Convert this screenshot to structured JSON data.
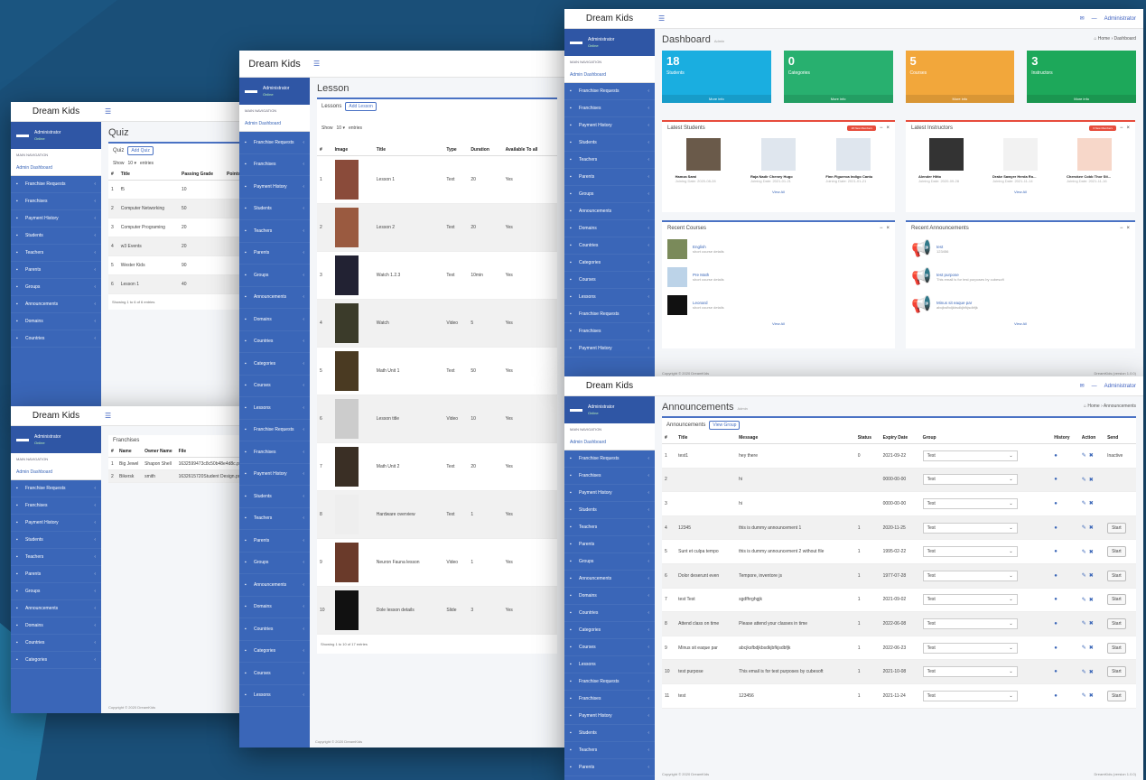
{
  "brand": "Dream Kids",
  "user": {
    "name": "Administrator",
    "status": "Online"
  },
  "nav_header": "MAIN NAVIGATION",
  "nav_dashboard": "Admin Dashboard",
  "nav_items": [
    "Franchise Requests",
    "Franchises",
    "Payment History",
    "Students",
    "Teachers",
    "Parents",
    "Groups",
    "Announcements",
    "Domains",
    "Countries",
    "Categories",
    "Courses",
    "Lessons"
  ],
  "top_user": "Administrator",
  "quiz": {
    "title": "Quiz",
    "tab": "Quiz",
    "add_btn": "Add Quiz",
    "show": "Show",
    "entries": "entries",
    "headers": [
      "#",
      "Title",
      "Passing Grade",
      "Points"
    ],
    "rows": [
      [
        "1",
        "f5",
        "10",
        ""
      ],
      [
        "2",
        "Computer Networking",
        "50",
        ""
      ],
      [
        "3",
        "Computer Programing",
        "20",
        ""
      ],
      [
        "4",
        "w3 Events",
        "20",
        ""
      ],
      [
        "5",
        "Wester Kids",
        "90",
        ""
      ],
      [
        "6",
        "Lesson 1",
        "40",
        ""
      ]
    ],
    "info": "Showing 1 to 6 of 6 entries",
    "footer": "Copyright © 2020 DreamKids"
  },
  "franchises": {
    "title": "Franchises",
    "headers": [
      "#",
      "Name",
      "Owner Name",
      "File"
    ],
    "rows": [
      [
        "1",
        "Big Jewel",
        "Shapon Shell",
        "1632599473c8c50b48e4d8c.pdf"
      ],
      [
        "2",
        "Bikersk",
        "smith",
        "1632615720Student Design.pdf"
      ]
    ],
    "footer": "Copyright © 2020 DreamKids"
  },
  "lesson": {
    "title": "Lesson",
    "tab": "Lessons",
    "add_btn": "Add Lesson",
    "show": "Show",
    "entries": "entries",
    "headers": [
      "#",
      "Image",
      "Title",
      "Type",
      "Duration",
      "Available To all"
    ],
    "rows": [
      [
        "1",
        "Lesson 1",
        "Text",
        "20",
        "Yes"
      ],
      [
        "2",
        "Lesson 2",
        "Text",
        "20",
        "Yes"
      ],
      [
        "3",
        "Watch 1.2.3",
        "Text",
        "10min",
        "Yes"
      ],
      [
        "4",
        "Watch",
        "Video",
        "5",
        "Yes"
      ],
      [
        "5",
        "Math Unit 1",
        "Text",
        "50",
        "Yes"
      ],
      [
        "6",
        "Lesson title",
        "Video",
        "10",
        "Yes"
      ],
      [
        "7",
        "Math Unit 2",
        "Text",
        "20",
        "Yes"
      ],
      [
        "8",
        "Hardware overview",
        "Text",
        "1",
        "Yes"
      ],
      [
        "9",
        "Neuron Fauna lesson",
        "Video",
        "1",
        "Yes"
      ],
      [
        "10",
        "Dole lesson details",
        "Slide",
        "3",
        "Yes"
      ]
    ],
    "info": "Showing 1 to 10 of 17 entries",
    "footer": "Copyright © 2020 DreamKids"
  },
  "dashboard": {
    "title": "Dashboard",
    "sub": "Admin",
    "crumb_home": "Home",
    "crumb_current": "Dashboard",
    "stats": [
      {
        "n": "18",
        "label": "Students",
        "more": "More info",
        "color": "#1aaee0"
      },
      {
        "n": "0",
        "label": "Categories",
        "more": "More info",
        "color": "#28b06f"
      },
      {
        "n": "5",
        "label": "Courses",
        "more": "More info",
        "color": "#f2a73b"
      },
      {
        "n": "3",
        "label": "Instructors",
        "more": "More info",
        "color": "#1da85a"
      }
    ],
    "latest_students": {
      "title": "Latest Students",
      "badge": "18 New Members",
      "people": [
        {
          "name": "Hamza Sami",
          "date": "Joining Date: 2020-08-28"
        },
        {
          "name": "Raja Nadir Cheney Hugo",
          "date": "Joining Date: 2021-01-21"
        },
        {
          "name": "Finn Figueroa Indigo Cantu",
          "date": "Joining Date: 2021-01-21"
        }
      ],
      "view_all": "View All"
    },
    "latest_instructors": {
      "title": "Latest Instructors",
      "badge": "3 New Members",
      "people": [
        {
          "name": "Alender Hitto",
          "date": "Joining Date: 2020-09-28"
        },
        {
          "name": "Drake Sawyer Herda Ro...",
          "date": "Joining Date: 2021-11-14"
        },
        {
          "name": "Cherokee Cobb Thor Sti...",
          "date": "Joining Date: 2021-11-16"
        }
      ],
      "view_all": "View All"
    },
    "recent_courses": {
      "title": "Recent Courses",
      "items": [
        {
          "t": "English",
          "s": "short course details"
        },
        {
          "t": "Pre Math",
          "s": "short course details"
        },
        {
          "t": "Leonard",
          "s": "short course details"
        }
      ],
      "view_all": "View All"
    },
    "recent_announcements": {
      "title": "Recent Announcements",
      "items": [
        {
          "t": "test",
          "s": "123456"
        },
        {
          "t": "test purpose",
          "s": "This email is for test purposes by cubesoft"
        },
        {
          "t": "Minus sit eaque par",
          "s": "abcjksfbdjkbsdkjbfkjsdbfjk"
        }
      ],
      "view_all": "View All"
    },
    "footer": "Copyright © 2020 DreamKids",
    "version": "DreamKids (version 1.0.0)"
  },
  "announcements": {
    "title": "Announcements",
    "sub": "Admin",
    "crumb_home": "Home",
    "crumb_current": "Announcements",
    "tab": "Announcements",
    "group_btn": "View Group",
    "headers": [
      "#",
      "Title",
      "Message",
      "Status",
      "Expiry Date",
      "Group",
      "History",
      "Action",
      "Send"
    ],
    "rows": [
      [
        "1",
        "test1",
        "hey there",
        "0",
        "2021-09-22",
        "Test",
        "Inactive"
      ],
      [
        "2",
        "",
        "hi",
        "",
        "0000-00-00",
        "Test",
        ""
      ],
      [
        "3",
        "",
        "hi",
        "",
        "0000-00-00",
        "Test",
        ""
      ],
      [
        "4",
        "12345",
        "this is dummy announcement 1",
        "1",
        "2020-11-25",
        "Test",
        "Start"
      ],
      [
        "5",
        "Sunt et culpa tempo",
        "this is dummy announcement 2 without file",
        "1",
        "1995-02-22",
        "Test",
        "Start"
      ],
      [
        "6",
        "Dolor deserunt even",
        "Tempore, inventore js",
        "1",
        "1977-07-28",
        "Test",
        "Start"
      ],
      [
        "7",
        "test Test",
        "sgdfhrghgjk",
        "1",
        "2021-09-02",
        "Test",
        "Start"
      ],
      [
        "8",
        "Attend class on time",
        "Please attend your classes in time",
        "1",
        "2022-06-08",
        "Test",
        "Start"
      ],
      [
        "9",
        "Minus sit eaque par",
        "abcjksfbdjkbsdkjbfkjsdbfjk",
        "1",
        "2022-06-23",
        "Test",
        "Start"
      ],
      [
        "10",
        "test purpose",
        "This email is for test purposes by cubesoft",
        "1",
        "2021-10-08",
        "Test",
        "Start"
      ],
      [
        "11",
        "test",
        "123456",
        "1",
        "2021-11-24",
        "Test",
        "Start"
      ]
    ],
    "footer": "Copyright © 2020 DreamKids",
    "version": "DreamKids (version 1.0.0)"
  }
}
